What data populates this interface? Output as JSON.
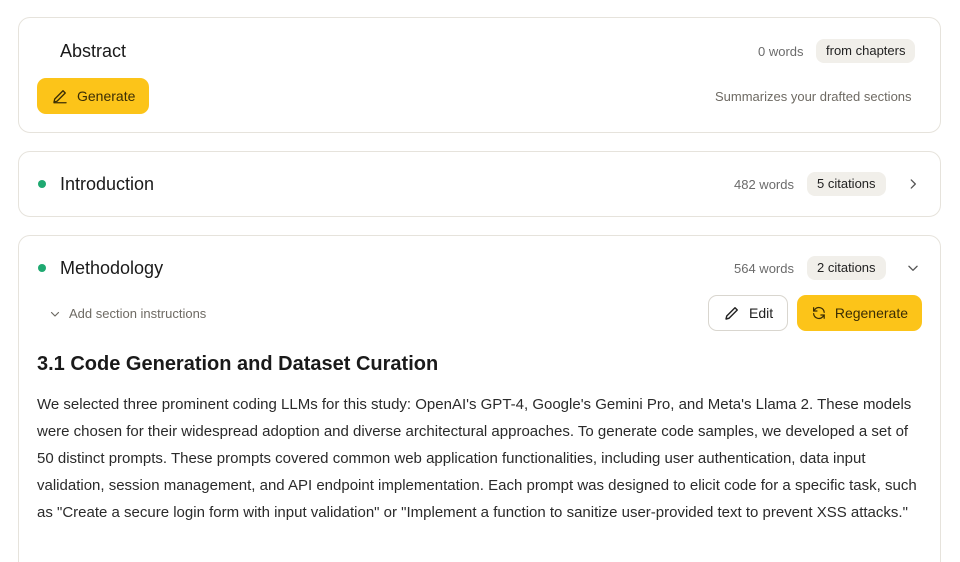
{
  "abstract": {
    "title": "Abstract",
    "words": "0 words",
    "chip": "from chapters",
    "generate_label": "Generate",
    "hint": "Summarizes your drafted sections"
  },
  "introduction": {
    "title": "Introduction",
    "words": "482 words",
    "citations": "5 citations",
    "status_color": "#1fa971"
  },
  "methodology": {
    "title": "Methodology",
    "words": "564 words",
    "citations": "2 citations",
    "status_color": "#1fa971",
    "instructions_label": "Add section instructions",
    "edit_label": "Edit",
    "regenerate_label": "Regenerate",
    "heading": "3.1 Code Generation and Dataset Curation",
    "paragraph": "We selected three prominent coding LLMs for this study: OpenAI's GPT-4, Google's Gemini Pro, and Meta's Llama 2. These models were chosen for their widespread adoption and diverse architectural approaches. To generate code samples, we developed a set of 50 distinct prompts. These prompts covered common web application functionalities, including user authentication, data input validation, session management, and API endpoint implementation. Each prompt was designed to elicit code for a specific task, such as \"Create a secure login form with input validation\" or \"Implement a function to sanitize user-provided text to prevent XSS attacks.\""
  },
  "colors": {
    "accent": "#fcc419",
    "status": "#1fa971"
  }
}
